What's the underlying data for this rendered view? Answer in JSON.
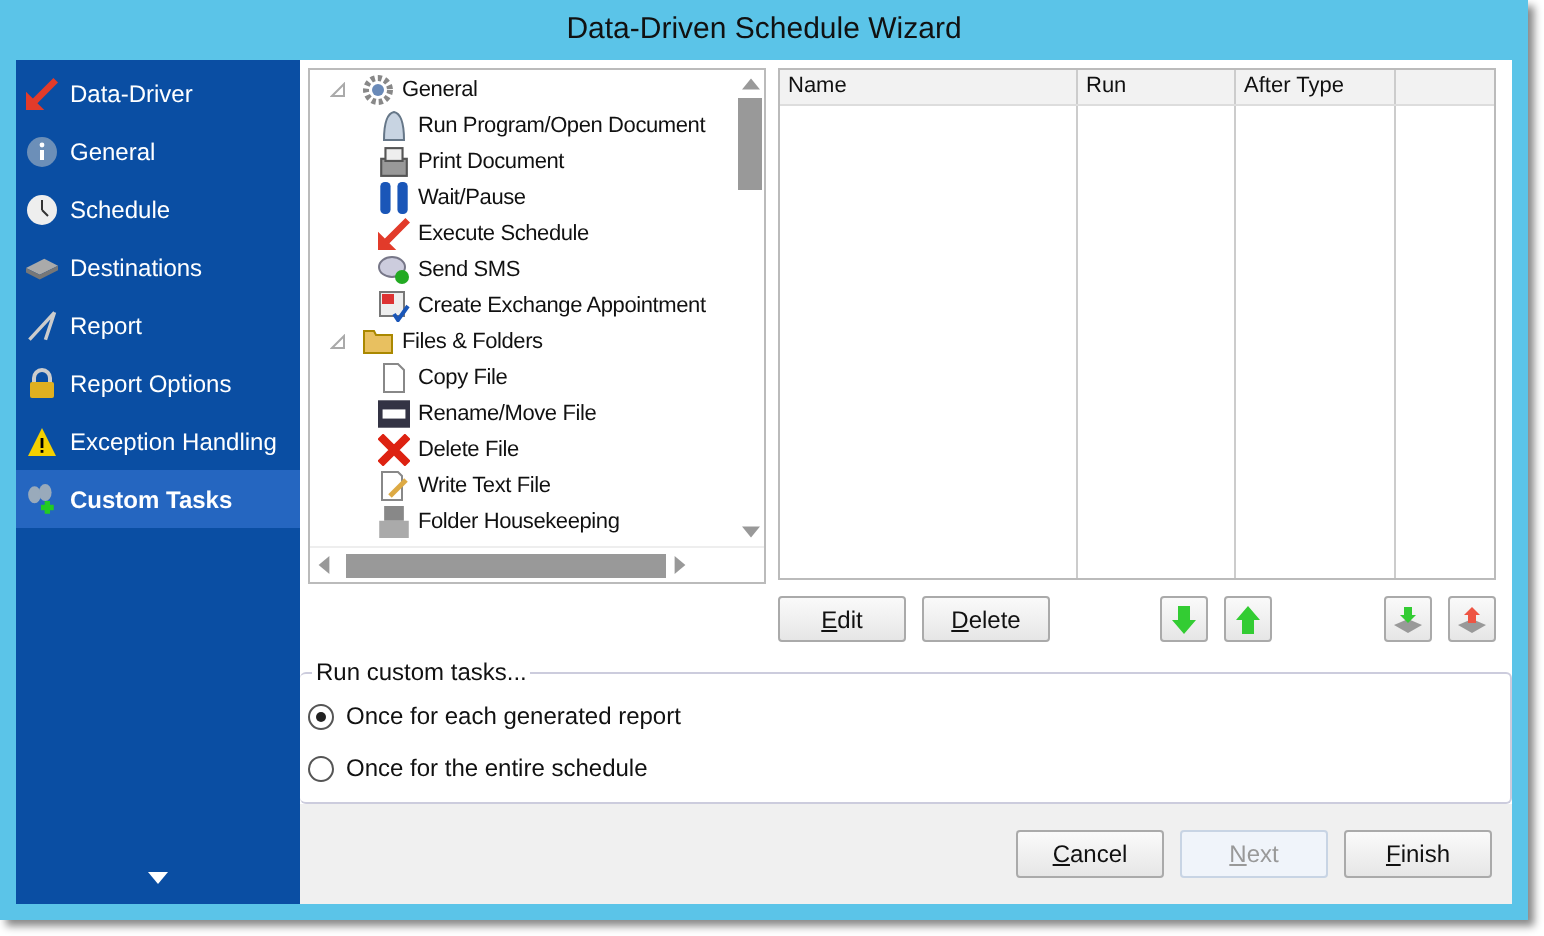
{
  "window": {
    "title": "Data-Driven Schedule Wizard"
  },
  "sidebar": {
    "items": [
      {
        "label": "Data-Driver",
        "selected": false
      },
      {
        "label": "General",
        "selected": false
      },
      {
        "label": "Schedule",
        "selected": false
      },
      {
        "label": "Destinations",
        "selected": false
      },
      {
        "label": "Report",
        "selected": false
      },
      {
        "label": "Report Options",
        "selected": false
      },
      {
        "label": "Exception Handling",
        "selected": false
      },
      {
        "label": "Custom Tasks",
        "selected": true
      }
    ]
  },
  "tree": {
    "items": [
      {
        "label": "General",
        "expanded": true,
        "children": [
          {
            "label": "Run Program/Open Document"
          },
          {
            "label": "Print Document"
          },
          {
            "label": "Wait/Pause"
          },
          {
            "label": "Execute Schedule"
          },
          {
            "label": "Send SMS"
          },
          {
            "label": "Create Exchange Appointment"
          }
        ]
      },
      {
        "label": "Files & Folders",
        "expanded": true,
        "children": [
          {
            "label": "Copy File"
          },
          {
            "label": "Rename/Move File"
          },
          {
            "label": "Delete File"
          },
          {
            "label": "Write Text File"
          },
          {
            "label": "Folder Housekeeping"
          }
        ]
      }
    ]
  },
  "table": {
    "columns": [
      "Name",
      "Run",
      "After Type"
    ]
  },
  "list_buttons": [
    {
      "label": "Edit"
    },
    {
      "label": "Delete"
    }
  ],
  "run_options": {
    "legend": "Run custom tasks...",
    "options": [
      {
        "label": "Once for each generated report",
        "selected": true
      },
      {
        "label": "Once for the entire schedule",
        "selected": false
      }
    ]
  },
  "footer_buttons": [
    {
      "label": "Cancel",
      "disabled": false
    },
    {
      "label": "Next",
      "disabled": true
    },
    {
      "label": "Finish",
      "disabled": false
    }
  ]
}
